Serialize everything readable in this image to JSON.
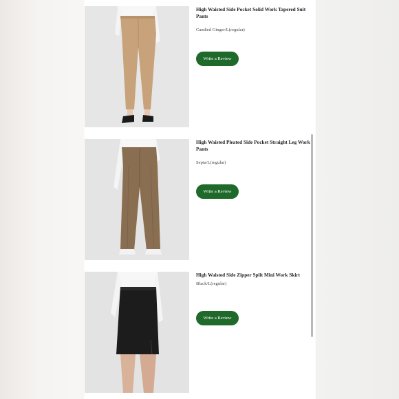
{
  "items": [
    {
      "title": "High Waisted Side Pocket Solid Work Tapered Suit Pants",
      "variant": "Candied Ginger/L(regular)",
      "button": "Write a Review",
      "image_icon": "tan-tapered-pants-photo",
      "color": "#c7a27a"
    },
    {
      "title": "High Waisted Pleated Side Pocket Straight Leg Work Pants",
      "variant": "Sepia/L(regular)",
      "button": "Write a Review",
      "image_icon": "brown-straight-leg-pants-photo",
      "color": "#8a6e52"
    },
    {
      "title": "High Waisted Side Zipper Split Mini Work Skirt",
      "variant": "Black/L(regular)",
      "button": "Write a Review",
      "image_icon": "black-mini-skirt-photo",
      "color": "#1c1c1c"
    }
  ],
  "accent_color": "#1f6a2b"
}
